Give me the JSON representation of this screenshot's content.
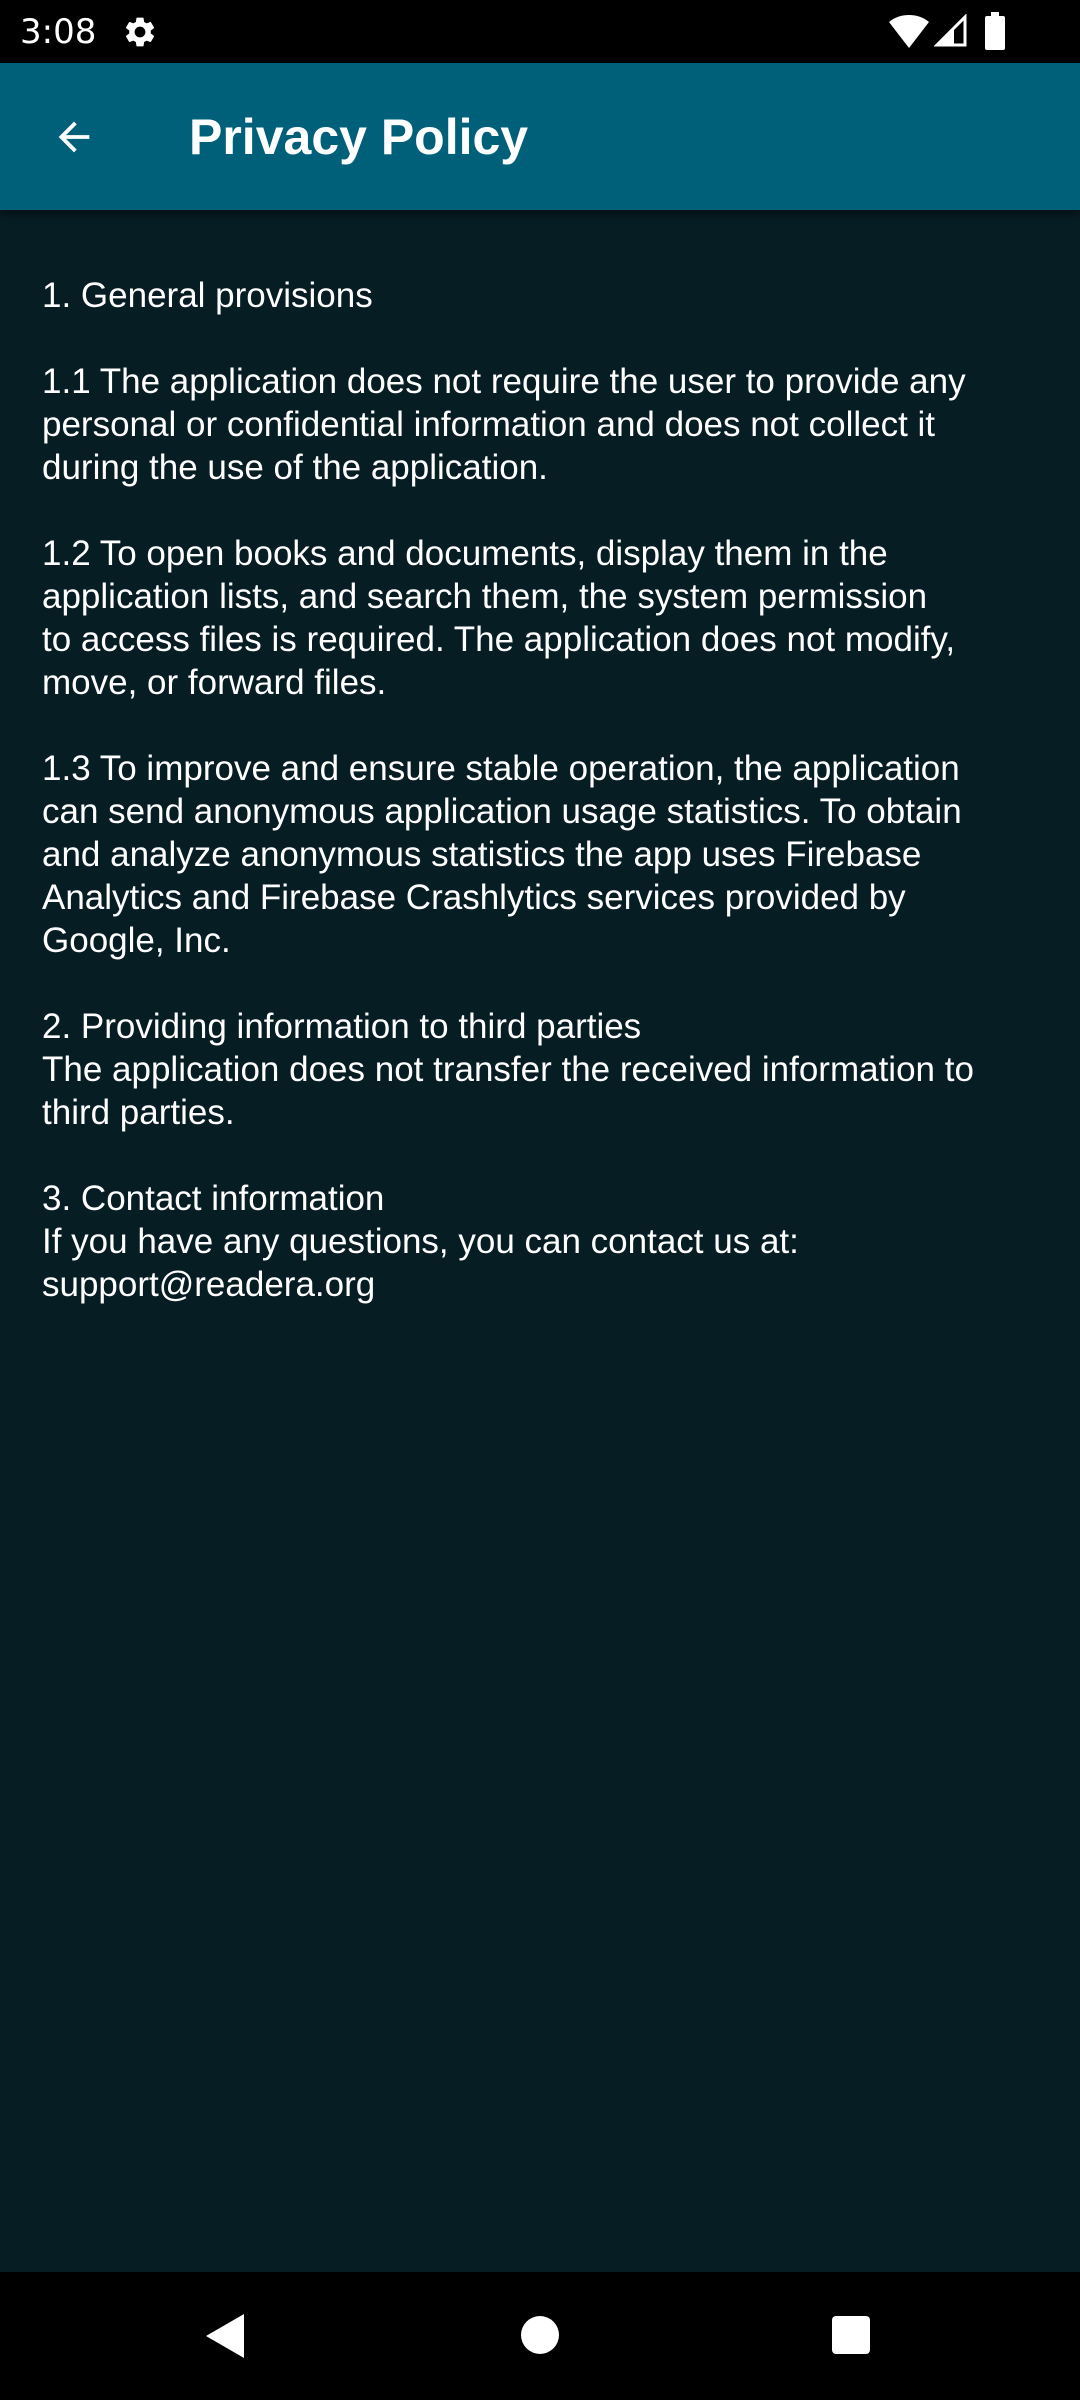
{
  "status_bar": {
    "time": "3:08",
    "icons": [
      "gear-icon",
      "wifi-icon",
      "signal-icon",
      "battery-icon"
    ]
  },
  "app_bar": {
    "title": "Privacy Policy",
    "back_icon": "arrow-left-icon",
    "color": "#00607a"
  },
  "policy": {
    "sections": [
      {
        "lines": [
          "1. General provisions"
        ]
      },
      {
        "lines": [
          "1.1 The application does not require the user to provide any",
          "personal or confidential information and does not collect it",
          "during the use of the application."
        ]
      },
      {
        "lines": [
          "1.2 To open books and documents, display them in the",
          "application lists, and search them, the system permission",
          "to access files is required. The application does not modify,",
          "move, or forward files."
        ]
      },
      {
        "lines": [
          "1.3 To improve and ensure stable operation, the application",
          "can send anonymous application usage statistics. To obtain",
          "and analyze anonymous statistics the app uses Firebase",
          "Analytics and Firebase Crashlytics services provided by",
          "Google, Inc."
        ]
      },
      {
        "lines": [
          "2. Providing information to third parties",
          "The application does not transfer the received information to",
          "third parties."
        ]
      },
      {
        "lines": [
          "3. Contact information",
          "If you have any questions, you can contact us at:",
          "support@readera.org"
        ]
      }
    ]
  },
  "nav_bar": {
    "icons": [
      "nav-back-icon",
      "nav-home-icon",
      "nav-recents-icon"
    ]
  },
  "colors": {
    "background": "#071d24",
    "app_bar": "#00607a",
    "text": "#ffffff"
  }
}
